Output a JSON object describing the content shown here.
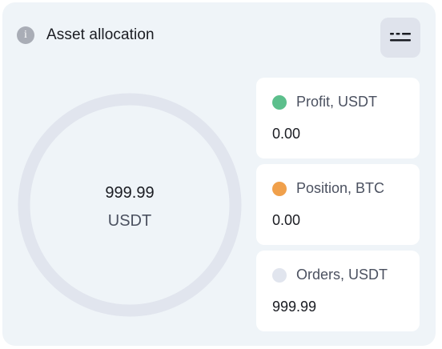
{
  "header": {
    "title": "Asset allocation",
    "info_icon": "info-icon",
    "menu_icon": "list-icon"
  },
  "donut": {
    "value": "999.99",
    "unit": "USDT",
    "track_color": "#e1e5ee"
  },
  "legend": [
    {
      "label": "Profit, USDT",
      "value": "0.00",
      "color": "#5cbf8c"
    },
    {
      "label": "Position, BTC",
      "value": "0.00",
      "color": "#f0a04b"
    },
    {
      "label": "Orders, USDT",
      "value": "999.99",
      "color": "#e1e5ee"
    }
  ]
}
